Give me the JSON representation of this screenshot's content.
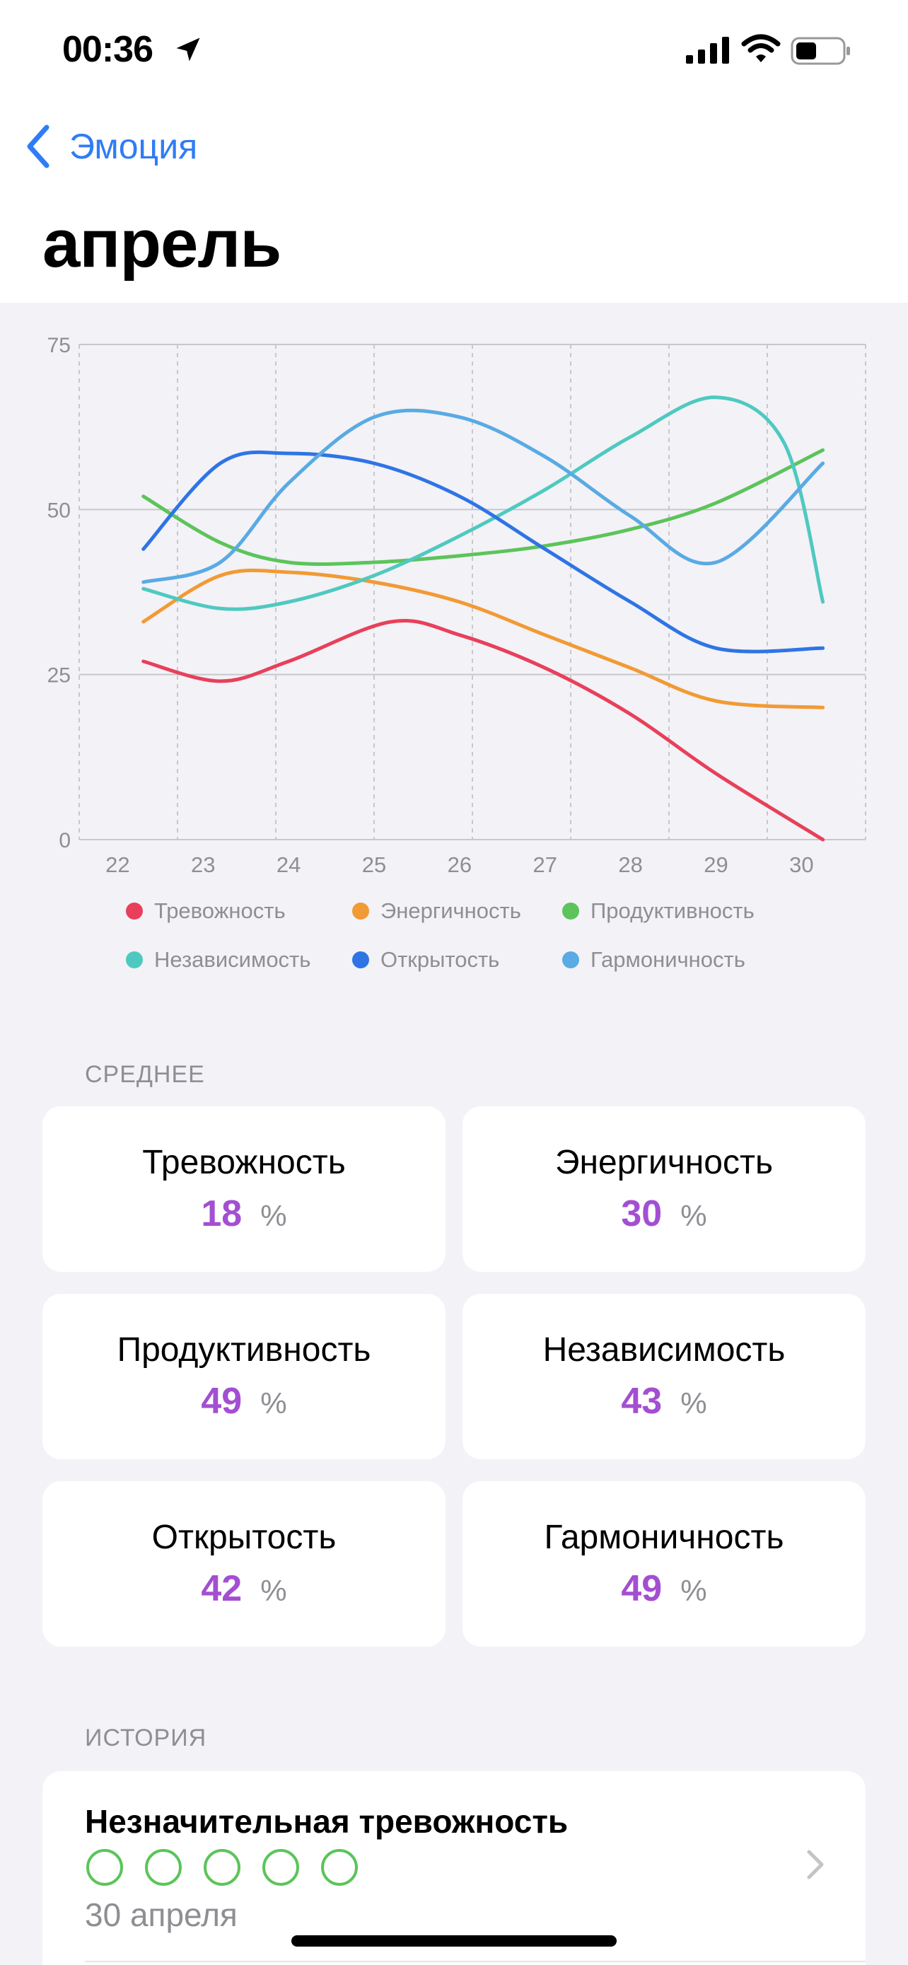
{
  "status": {
    "time": "00:36"
  },
  "nav": {
    "back_label": "Эмоция"
  },
  "page": {
    "title": "апрель"
  },
  "chart_data": {
    "type": "line",
    "x": [
      22,
      23,
      24,
      25,
      26,
      27,
      28,
      29,
      30
    ],
    "x_tick_labels": [
      "22",
      "23",
      "24",
      "25",
      "26",
      "27",
      "28",
      "29",
      "30"
    ],
    "y_tick_labels": [
      "75",
      "50",
      "25",
      "0"
    ],
    "ylim": [
      0,
      75
    ],
    "grid": true,
    "legend_position": "bottom",
    "series": [
      {
        "name": "Тревожность",
        "color": "#e8405a",
        "points": [
          [
            22.3,
            27
          ],
          [
            23.2,
            24
          ],
          [
            24,
            27
          ],
          [
            25.2,
            33
          ],
          [
            26,
            31
          ],
          [
            27,
            26
          ],
          [
            28,
            19
          ],
          [
            29,
            10
          ],
          [
            30.25,
            0
          ]
        ]
      },
      {
        "name": "Энергичность",
        "color": "#f29a33",
        "points": [
          [
            22.3,
            33
          ],
          [
            23.2,
            40
          ],
          [
            24,
            40.5
          ],
          [
            25,
            39
          ],
          [
            26,
            36
          ],
          [
            27,
            31
          ],
          [
            28,
            26
          ],
          [
            29,
            21
          ],
          [
            30.25,
            20
          ]
        ]
      },
      {
        "name": "Продуктивность",
        "color": "#5cc45a",
        "points": [
          [
            22.3,
            52
          ],
          [
            23.2,
            45
          ],
          [
            24,
            42
          ],
          [
            25,
            42
          ],
          [
            26,
            43
          ],
          [
            27,
            44.5
          ],
          [
            28,
            47
          ],
          [
            29,
            51
          ],
          [
            30.25,
            59
          ]
        ]
      },
      {
        "name": "Независимость",
        "color": "#4fc9c0",
        "points": [
          [
            22.3,
            38
          ],
          [
            23.2,
            35
          ],
          [
            24,
            36
          ],
          [
            25,
            40
          ],
          [
            26,
            46
          ],
          [
            27,
            53
          ],
          [
            28,
            61
          ],
          [
            29,
            67
          ],
          [
            29.8,
            60
          ],
          [
            30.25,
            36
          ]
        ]
      },
      {
        "name": "Открытость",
        "color": "#2f74e5",
        "points": [
          [
            22.3,
            44
          ],
          [
            23.2,
            57
          ],
          [
            24,
            58.5
          ],
          [
            25,
            57
          ],
          [
            26,
            52
          ],
          [
            27,
            44
          ],
          [
            28,
            36
          ],
          [
            29,
            29
          ],
          [
            30.25,
            29
          ]
        ]
      },
      {
        "name": "Гармоничность",
        "color": "#5aaae3",
        "points": [
          [
            22.3,
            39
          ],
          [
            23.2,
            42
          ],
          [
            24,
            54
          ],
          [
            25,
            64
          ],
          [
            26,
            64
          ],
          [
            27,
            58
          ],
          [
            28,
            49
          ],
          [
            29,
            42
          ],
          [
            30.25,
            57
          ]
        ]
      }
    ]
  },
  "averages": {
    "label": "СРЕДНЕЕ",
    "unit": "%",
    "items": [
      {
        "name": "Тревожность",
        "value": "18"
      },
      {
        "name": "Энергичность",
        "value": "30"
      },
      {
        "name": "Продуктивность",
        "value": "49"
      },
      {
        "name": "Независимость",
        "value": "43"
      },
      {
        "name": "Открытость",
        "value": "42"
      },
      {
        "name": "Гармоничность",
        "value": "49"
      }
    ]
  },
  "history": {
    "label": "ИСТОРИЯ",
    "entries": [
      {
        "title": "Незначительная тревожность",
        "date": "30 апреля",
        "rating_circles": 5
      }
    ]
  }
}
